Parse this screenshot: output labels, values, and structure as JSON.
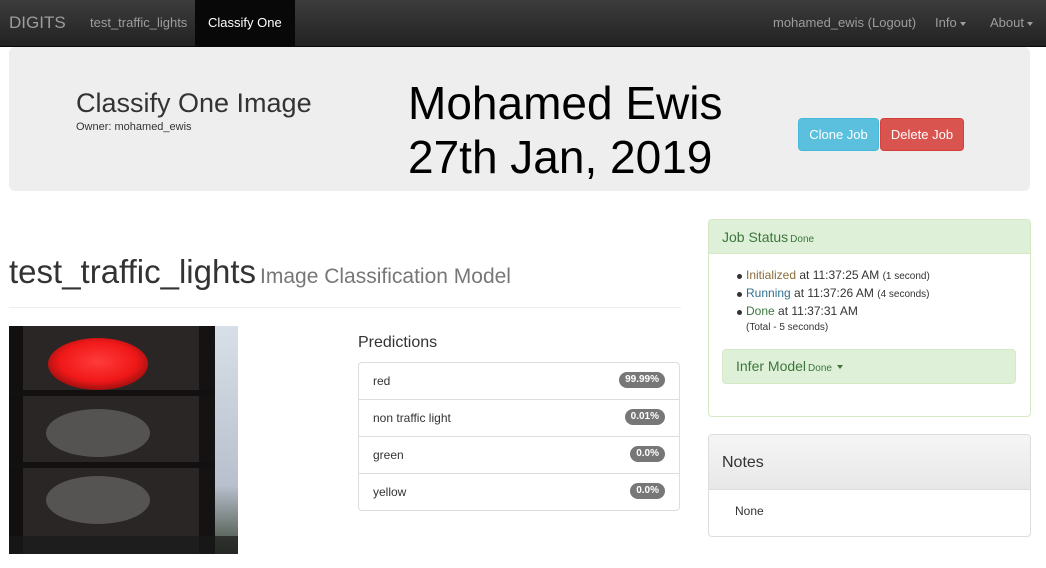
{
  "navbar": {
    "brand": "DIGITS",
    "links": [
      "test_traffic_lights",
      "Classify One"
    ],
    "user": "mohamed_ewis (Logout)",
    "info": "Info",
    "about": "About"
  },
  "jumbotron": {
    "title": "Classify One Image",
    "owner": "Owner: mohamed_ewis",
    "overlay_line1": "Mohamed Ewis",
    "overlay_line2": "27th Jan, 2019",
    "clone_label": "Clone Job",
    "delete_label": "Delete Job"
  },
  "model": {
    "name": "test_traffic_lights",
    "type": "Image Classification Model"
  },
  "predictions": {
    "heading": "Predictions",
    "items": [
      {
        "label": "red",
        "value": "99.99%"
      },
      {
        "label": "non traffic light",
        "value": "0.01%"
      },
      {
        "label": "green",
        "value": "0.0%"
      },
      {
        "label": "yellow",
        "value": "0.0%"
      }
    ]
  },
  "job_status": {
    "title": "Job Status",
    "state": "Done",
    "rows": [
      {
        "status": "Initialized",
        "at": "at 11:37:25 AM",
        "duration": "(1 second)"
      },
      {
        "status": "Running",
        "at": "at 11:37:26 AM",
        "duration": "(4 seconds)"
      },
      {
        "status": "Done",
        "at": "at 11:37:31 AM",
        "duration": ""
      }
    ],
    "total": "(Total - 5 seconds)",
    "infer_title": "Infer Model",
    "infer_state": "Done"
  },
  "notes": {
    "title": "Notes",
    "body": "None"
  },
  "colors": {
    "navbar": "#222222",
    "info_button": "#5bc0de",
    "danger_button": "#d9534f",
    "success_panel": "#dff0d8",
    "badge": "#777777",
    "traffic_light_red": "#ff2a2a"
  }
}
